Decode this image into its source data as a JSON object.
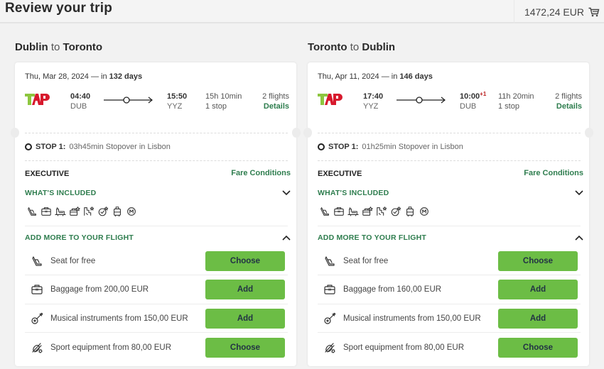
{
  "header": {
    "title": "Review your trip",
    "cart_total": "1472,24 EUR",
    "cart_icon": "shopping-cart-icon"
  },
  "legs": [
    {
      "origin_city": "Dublin",
      "connector": "to",
      "destination_city": "Toronto",
      "date": "Thu, Mar 28, 2024",
      "dash": "—",
      "in_prefix": "in",
      "days": "132 days",
      "airline_logo": "TAP",
      "departure_time": "04:40",
      "departure_code": "DUB",
      "arrival_time": "15:50",
      "arrival_day_offset": "",
      "arrival_code": "YYZ",
      "duration": "15h 10min",
      "stops": "1 stop",
      "flights": "2 flights",
      "details_label": "Details",
      "stop_label": "STOP 1:",
      "stop_text": "03h45min Stopover in Lisbon",
      "fare_class": "EXECUTIVE",
      "fare_conditions_label": "Fare Conditions",
      "included_label": "WHAT'S INCLUDED",
      "included_icons": [
        "seat-icon",
        "cabin-bag-icon",
        "checked-baggage-icon",
        "priority-bag-icon",
        "fast-track-icon",
        "priority-boarding-icon",
        "carry-on-icon",
        "miles-icon"
      ],
      "add_more_label": "ADD MORE TO YOUR FLIGHT",
      "addons": [
        {
          "icon": "seat-icon",
          "label": "Seat for free",
          "button": "Choose"
        },
        {
          "icon": "baggage-icon",
          "label": "Baggage from 200,00 EUR",
          "button": "Add"
        },
        {
          "icon": "guitar-icon",
          "label": "Musical instruments from 150,00 EUR",
          "button": "Add"
        },
        {
          "icon": "sport-equipment-icon",
          "label": "Sport equipment from 80,00 EUR",
          "button": "Choose"
        }
      ]
    },
    {
      "origin_city": "Toronto",
      "connector": "to",
      "destination_city": "Dublin",
      "date": "Thu, Apr 11, 2024",
      "dash": "—",
      "in_prefix": "in",
      "days": "146 days",
      "airline_logo": "TAP",
      "departure_time": "17:40",
      "departure_code": "YYZ",
      "arrival_time": "10:00",
      "arrival_day_offset": "+1",
      "arrival_code": "DUB",
      "duration": "11h 20min",
      "stops": "1 stop",
      "flights": "2 flights",
      "details_label": "Details",
      "stop_label": "STOP 1:",
      "stop_text": "01h25min Stopover in Lisbon",
      "fare_class": "EXECUTIVE",
      "fare_conditions_label": "Fare Conditions",
      "included_label": "WHAT'S INCLUDED",
      "included_icons": [
        "seat-icon",
        "cabin-bag-icon",
        "checked-baggage-icon",
        "priority-bag-icon",
        "fast-track-icon",
        "priority-boarding-icon",
        "carry-on-icon",
        "miles-icon"
      ],
      "add_more_label": "ADD MORE TO YOUR FLIGHT",
      "addons": [
        {
          "icon": "seat-icon",
          "label": "Seat for free",
          "button": "Choose"
        },
        {
          "icon": "baggage-icon",
          "label": "Baggage from 160,00 EUR",
          "button": "Add"
        },
        {
          "icon": "guitar-icon",
          "label": "Musical instruments from 150,00 EUR",
          "button": "Add"
        },
        {
          "icon": "sport-equipment-icon",
          "label": "Sport equipment from 80,00 EUR",
          "button": "Choose"
        }
      ]
    }
  ]
}
